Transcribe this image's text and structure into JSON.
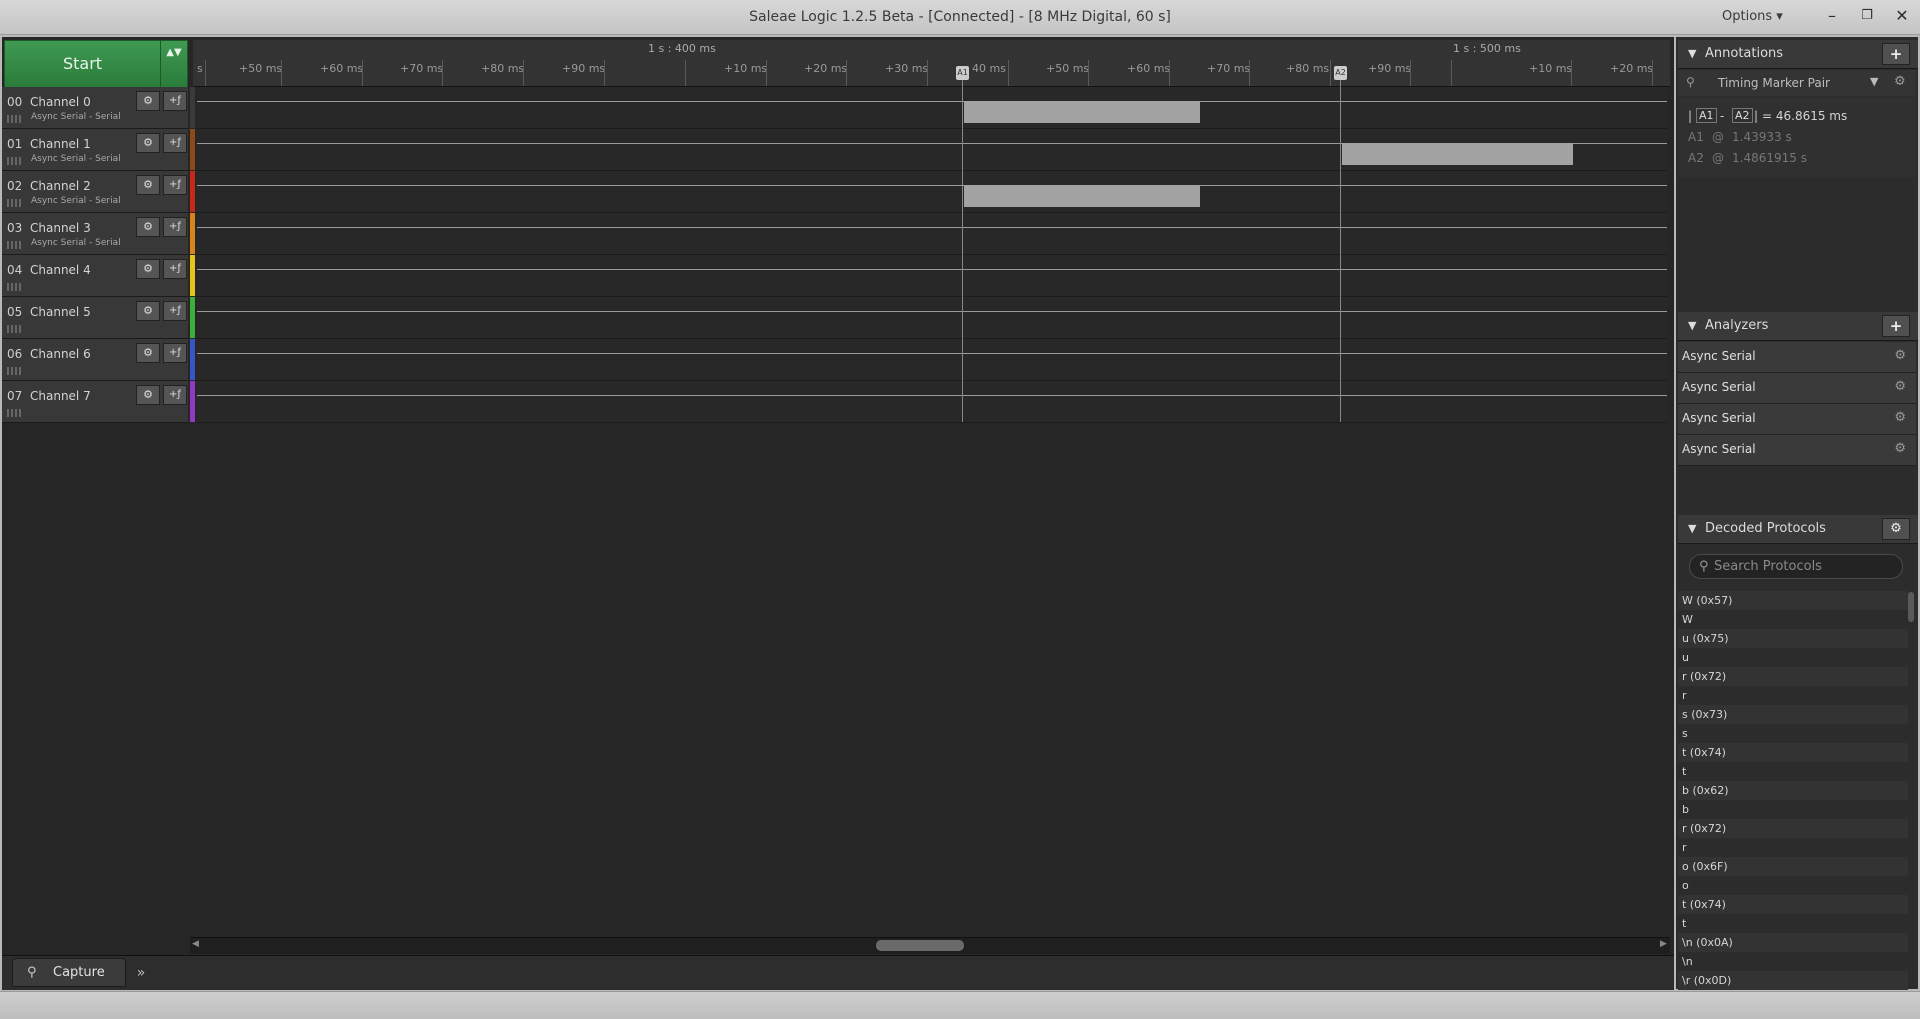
{
  "window": {
    "title": "Saleae Logic 1.2.5 Beta - [Connected] - [8 MHz Digital, 60 s]",
    "options_label": "Options ▾",
    "minimize": "–",
    "restore": "❐",
    "close": "✕"
  },
  "capture": {
    "start_label": "Start",
    "arrows": "▲▼"
  },
  "ruler": {
    "top_labels": [
      "1 s : 400 ms",
      "1 s : 500 ms"
    ],
    "tick_labels": [
      "s",
      "+50 ms",
      "+60 ms",
      "+70 ms",
      "+80 ms",
      "+90 ms",
      "+10 ms",
      "+20 ms",
      "+30 ms",
      "40 ms",
      "+50 ms",
      "+60 ms",
      "+70 ms",
      "+80 ms",
      "+90 ms",
      "+10 ms",
      "+20 ms"
    ],
    "marker_labels": [
      "A1",
      "A2"
    ]
  },
  "channels": [
    {
      "num": "00",
      "name": "Channel 0",
      "sub": "Async Serial - Serial",
      "color": "#3a3a3a"
    },
    {
      "num": "01",
      "name": "Channel 1",
      "sub": "Async Serial - Serial",
      "color": "#8a4a1a"
    },
    {
      "num": "02",
      "name": "Channel 2",
      "sub": "Async Serial - Serial",
      "color": "#c42a1a"
    },
    {
      "num": "03",
      "name": "Channel 3",
      "sub": "Async Serial - Serial",
      "color": "#d8831b"
    },
    {
      "num": "04",
      "name": "Channel 4",
      "sub": "",
      "color": "#e6c51a"
    },
    {
      "num": "05",
      "name": "Channel 5",
      "sub": "",
      "color": "#3eae3a"
    },
    {
      "num": "06",
      "name": "Channel 6",
      "sub": "",
      "color": "#3556c8"
    },
    {
      "num": "07",
      "name": "Channel 7",
      "sub": "",
      "color": "#8e3ac2"
    }
  ],
  "channel_buttons": {
    "settings": "⚙",
    "trigger": "+ƒ"
  },
  "bottom": {
    "capture_tab": "Capture",
    "more": "»"
  },
  "annotations": {
    "title": "Annotations",
    "add": "+",
    "marker_type": "Timing Marker Pair",
    "diff_a1": "A1",
    "diff_sep": "-",
    "diff_a2": "A2",
    "diff_value": "= 46.8615 ms",
    "a1_label": "A1",
    "a1_at": "@",
    "a1_value": "1.43933 s",
    "a2_label": "A2",
    "a2_at": "@",
    "a2_value": "1.4861915 s"
  },
  "analyzers": {
    "title": "Analyzers",
    "add": "+",
    "items": [
      "Async Serial",
      "Async Serial",
      "Async Serial",
      "Async Serial"
    ]
  },
  "decoded": {
    "title": "Decoded Protocols",
    "search_placeholder": "Search Protocols",
    "rows": [
      "W (0x57)",
      "W",
      "u (0x75)",
      "u",
      "r (0x72)",
      "r",
      "s (0x73)",
      "s",
      "t (0x74)",
      "t",
      "b (0x62)",
      "b",
      "r (0x72)",
      "r",
      "o (0x6F)",
      "o",
      "t (0x74)",
      "t",
      "\\n (0x0A)",
      "\\n",
      "\\r (0x0D)"
    ]
  }
}
